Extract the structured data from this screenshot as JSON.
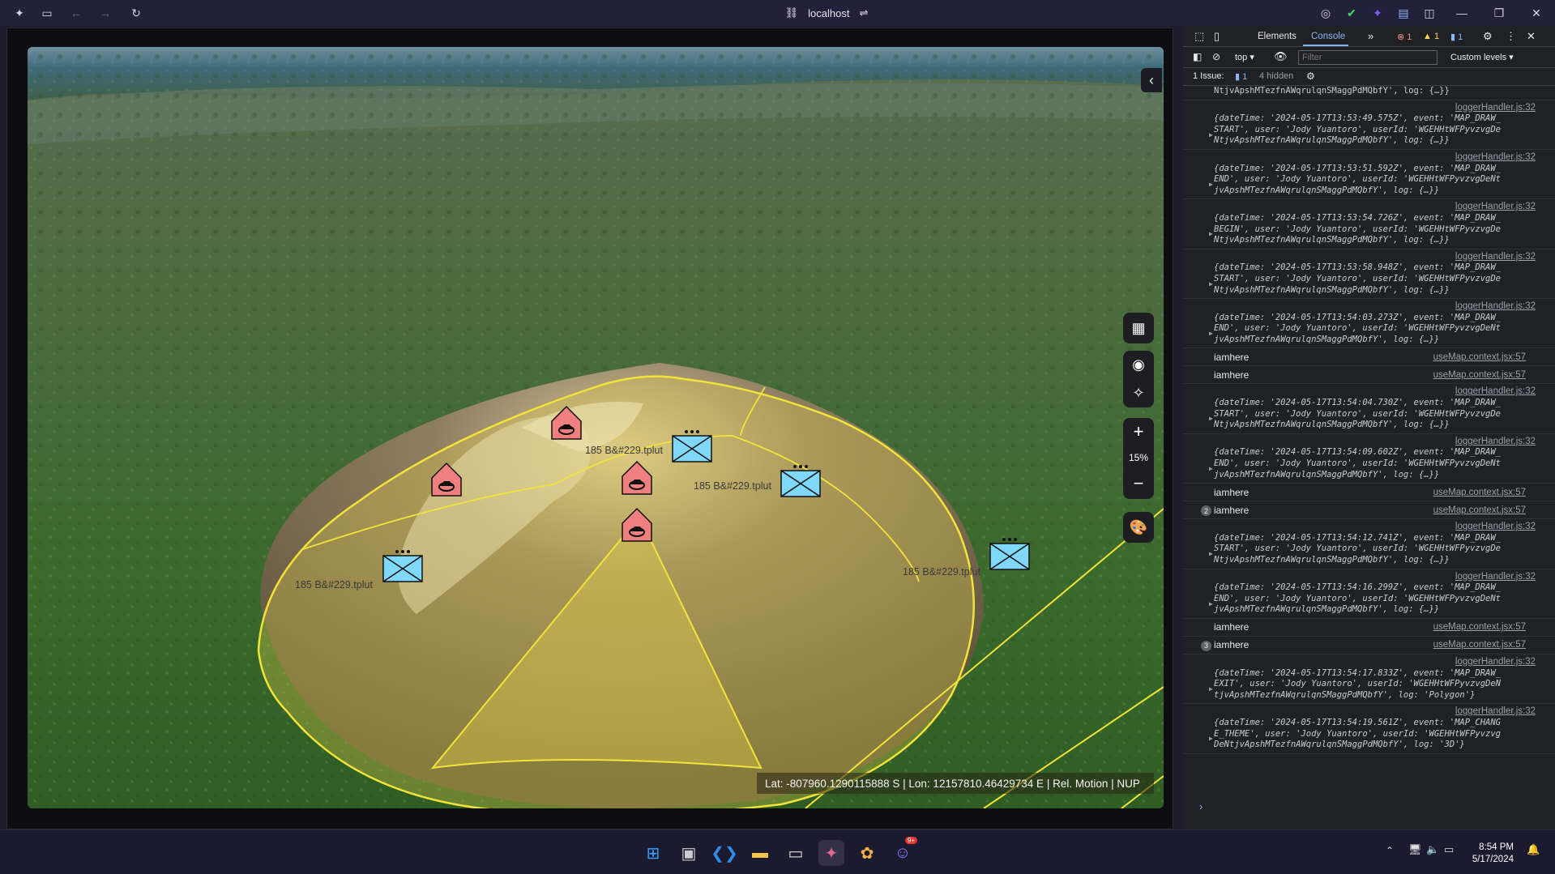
{
  "browser": {
    "address": "localhost"
  },
  "map": {
    "unit_labels": [
      "185 B&#229.tplut",
      "185 B&#229.tplut",
      "185 B&#229.tplut",
      "185 B&#229.tplut"
    ],
    "zoom_level": "15%",
    "status": "Lat: -807960.1290115888 S | Lon: 12157810.46429734 E | Rel. Motion | NUP",
    "colors": {
      "polygon_stroke": "#f2e33a",
      "polygon_fill": "#e6d24a",
      "hostile_fill": "#f08080",
      "friendly_fill": "#80d8f8"
    },
    "controls": [
      "calculator-icon",
      "locate-icon",
      "rotate-icon",
      "zoom-in-icon",
      "zoom-out-icon",
      "palette-icon"
    ]
  },
  "devtools": {
    "tabs": [
      "Elements",
      "Console"
    ],
    "active_tab": "Console",
    "errors": "1",
    "warnings": "1",
    "infos": "1",
    "context": "top",
    "filter_placeholder": "Filter",
    "levels": "Custom levels",
    "issues_label": "1 Issue:",
    "issues_count": "1",
    "hidden": "4 hidden",
    "top_cut": "NtjvApshMTezfnAWqrulqnSMaggPdMQbfY', log: {…}}",
    "entries": [
      {
        "type": "obj",
        "src": "loggerHandler.js:32",
        "l1": "{dateTime: '2024-05-17T13:53:49.575Z', event: 'MAP_DRAW_",
        "l2": "START', user: 'Jody Yuantoro', userId: 'WGEHHtWFPyvzvgDe",
        "l3": "NtjvApshMTezfnAWqrulqnSMaggPdMQbfY', log: {…}}"
      },
      {
        "type": "obj",
        "src": "loggerHandler.js:32",
        "l1": "{dateTime: '2024-05-17T13:53:51.592Z', event: 'MAP_DRAW_",
        "l2": "END', user: 'Jody Yuantoro', userId: 'WGEHHtWFPyvzvgDeNt",
        "l3": "jvApshMTezfnAWqrulqnSMaggPdMQbfY', log: {…}}"
      },
      {
        "type": "obj",
        "src": "loggerHandler.js:32",
        "l1": "{dateTime: '2024-05-17T13:53:54.726Z', event: 'MAP_DRAW_",
        "l2": "BEGIN', user: 'Jody Yuantoro', userId: 'WGEHHtWFPyvzvgDe",
        "l3": "NtjvApshMTezfnAWqrulqnSMaggPdMQbfY', log: {…}}"
      },
      {
        "type": "obj",
        "src": "loggerHandler.js:32",
        "l1": "{dateTime: '2024-05-17T13:53:58.948Z', event: 'MAP_DRAW_",
        "l2": "START', user: 'Jody Yuantoro', userId: 'WGEHHtWFPyvzvgDe",
        "l3": "NtjvApshMTezfnAWqrulqnSMaggPdMQbfY', log: {…}}"
      },
      {
        "type": "obj",
        "src": "loggerHandler.js:32",
        "l1": "{dateTime: '2024-05-17T13:54:03.273Z', event: 'MAP_DRAW_",
        "l2": "END', user: 'Jody Yuantoro', userId: 'WGEHHtWFPyvzvgDeNt",
        "l3": "jvApshMTezfnAWqrulqnSMaggPdMQbfY', log: {…}}"
      },
      {
        "type": "plain",
        "text": "iamhere",
        "src": "useMap.context.jsx:57",
        "count": ""
      },
      {
        "type": "plain",
        "text": "iamhere",
        "src": "useMap.context.jsx:57",
        "count": ""
      },
      {
        "type": "obj",
        "src": "loggerHandler.js:32",
        "l1": "{dateTime: '2024-05-17T13:54:04.730Z', event: 'MAP_DRAW_",
        "l2": "START', user: 'Jody Yuantoro', userId: 'WGEHHtWFPyvzvgDe",
        "l3": "NtjvApshMTezfnAWqrulqnSMaggPdMQbfY', log: {…}}"
      },
      {
        "type": "obj",
        "src": "loggerHandler.js:32",
        "l1": "{dateTime: '2024-05-17T13:54:09.602Z', event: 'MAP_DRAW_",
        "l2": "END', user: 'Jody Yuantoro', userId: 'WGEHHtWFPyvzvgDeNt",
        "l3": "jvApshMTezfnAWqrulqnSMaggPdMQbfY', log: {…}}"
      },
      {
        "type": "plain",
        "text": "iamhere",
        "src": "useMap.context.jsx:57",
        "count": ""
      },
      {
        "type": "plain",
        "text": "iamhere",
        "src": "useMap.context.jsx:57",
        "count": "2"
      },
      {
        "type": "obj",
        "src": "loggerHandler.js:32",
        "l1": "{dateTime: '2024-05-17T13:54:12.741Z', event: 'MAP_DRAW_",
        "l2": "START', user: 'Jody Yuantoro', userId: 'WGEHHtWFPyvzvgDe",
        "l3": "NtjvApshMTezfnAWqrulqnSMaggPdMQbfY', log: {…}}"
      },
      {
        "type": "obj",
        "src": "loggerHandler.js:32",
        "l1": "{dateTime: '2024-05-17T13:54:16.299Z', event: 'MAP_DRAW_",
        "l2": "END', user: 'Jody Yuantoro', userId: 'WGEHHtWFPyvzvgDeNt",
        "l3": "jvApshMTezfnAWqrulqnSMaggPdMQbfY', log: {…}}"
      },
      {
        "type": "plain",
        "text": "iamhere",
        "src": "useMap.context.jsx:57",
        "count": ""
      },
      {
        "type": "plain",
        "text": "iamhere",
        "src": "useMap.context.jsx:57",
        "count": "3"
      },
      {
        "type": "obj",
        "src": "loggerHandler.js:32",
        "l1": "{dateTime: '2024-05-17T13:54:17.833Z', event: 'MAP_DRAW_",
        "l2": "EXIT', user: 'Jody Yuantoro', userId: 'WGEHHtWFPyvzvgDeN",
        "l3": "tjvApshMTezfnAWqrulqnSMaggPdMQbfY', log: 'Polygon'}"
      },
      {
        "type": "obj",
        "src": "loggerHandler.js:32",
        "l1": "{dateTime: '2024-05-17T13:54:19.561Z', event: 'MAP_CHANG",
        "l2": "E_THEME', user: 'Jody Yuantoro', userId: 'WGEHHtWFPyvzvg",
        "l3": "DeNtjvApshMTezfnAWqrulqnSMaggPdMQbfY', log: '3D'}"
      }
    ]
  },
  "taskbar": {
    "time": "8:54 PM",
    "date": "5/17/2024",
    "badge": "9+"
  }
}
